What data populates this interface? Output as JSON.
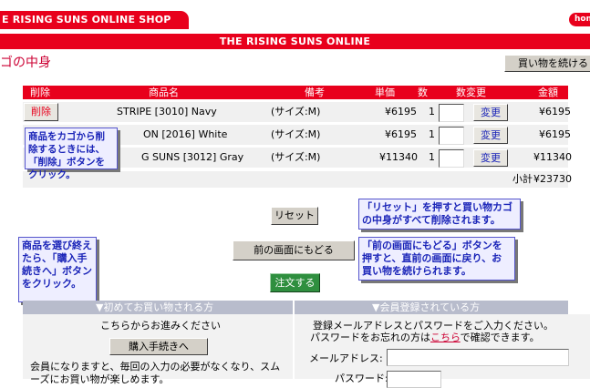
{
  "header": {
    "logo_text": "E RISING SUNS ONLINE SHOP",
    "home_label": "hom",
    "banner_text": "THE RISING SUNS ONLINE",
    "page_title": "ゴの中身",
    "continue_shopping": "買い物を続ける"
  },
  "cart": {
    "columns": [
      "削除",
      "商品名",
      "備考",
      "単価",
      "数",
      "数変更",
      "金額"
    ],
    "delete_label": "削除",
    "update_label": "変更",
    "rows": [
      {
        "name": "STRIPE [3010] Navy",
        "note": "(サイズ:M)",
        "price": "¥6195",
        "qty": "1",
        "amount": "¥6195"
      },
      {
        "name": "ON [2016] White",
        "note": "(サイズ:M)",
        "price": "¥6195",
        "qty": "1",
        "amount": "¥6195"
      },
      {
        "name": "G SUNS [3012] Gray",
        "note": "(サイズ:M)",
        "price": "¥11340",
        "qty": "1",
        "amount": "¥11340"
      }
    ],
    "subtotal_label": "小計",
    "subtotal_value": "¥23730"
  },
  "actions": {
    "reset": "リセット",
    "back": "前の画面にもどる",
    "order": "注文する"
  },
  "tips": {
    "delete_tip": "商品をカゴから削除するときには、「削除」ボタンをクリック。",
    "reset_tip": "「リセット」を押すと買い物カゴの中身がすべて削除されます。",
    "checkout_tip": "商品を選び終えたら、「購入手続きへ」ボタンをクリック。",
    "back_tip": "「前の画面にもどる」ボタンを押すと、直前の画面に戻り、お買い物を続けられます。"
  },
  "first_time": {
    "heading": "▼初めてお買い物される方",
    "lead": "こちらからお進みください",
    "button": "購入手続きへ",
    "body": "会員になりますと、毎回の入力の必要がなくなり、スムーズにお買い物が楽しめます。"
  },
  "member": {
    "heading": "▼会員登録されている方",
    "line1": "登録メールアドレスとパスワードをご入力ください。",
    "line2_before": "パスワードをお忘れの方は",
    "line2_link": "こちら",
    "line2_after": "で確認できます。",
    "email_label": "メールアドレス:",
    "password_label": "パスワード:"
  },
  "colors": {
    "brand_red": "#e8001c",
    "tip_text": "#1a24b8",
    "panel_head": "#b8bccc"
  }
}
